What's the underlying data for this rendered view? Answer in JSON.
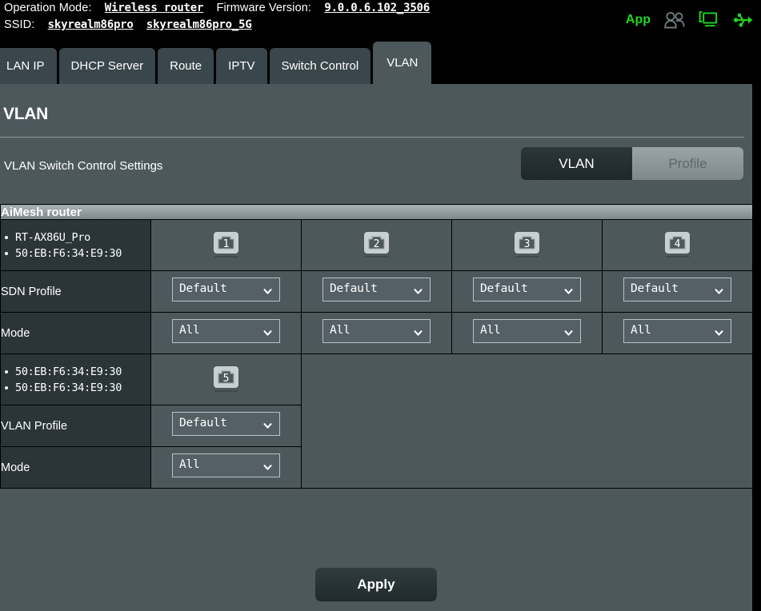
{
  "header": {
    "operation_mode_label": "Operation Mode:",
    "operation_mode_value": "Wireless router",
    "firmware_label": "Firmware Version:",
    "firmware_value": "9.0.0.6.102_3506",
    "ssid_label": "SSID:",
    "ssid_value_1": "skyrealm86pro",
    "ssid_value_2": "skyrealm86pro_5G",
    "app_label": "App",
    "icons": [
      "app-text",
      "users-icon",
      "monitor-icon",
      "usb-icon"
    ],
    "accent_green": "#1fd81f"
  },
  "tabs": [
    {
      "label": "LAN IP",
      "active": false
    },
    {
      "label": "DHCP Server",
      "active": false
    },
    {
      "label": "Route",
      "active": false
    },
    {
      "label": "IPTV",
      "active": false
    },
    {
      "label": "Switch Control",
      "active": false
    },
    {
      "label": "VLAN",
      "active": true
    }
  ],
  "page": {
    "title": "VLAN",
    "settings_label": "VLAN Switch Control Settings"
  },
  "view_toggle": {
    "vlan_label": "VLAN",
    "profile_label": "Profile",
    "selected": "VLAN"
  },
  "table": {
    "section_header": "AiMesh router",
    "blocks": [
      {
        "device": {
          "name": "RT-AX86U_Pro",
          "mac": "50:EB:F6:34:E9:30"
        },
        "ports": [
          "1",
          "2",
          "3",
          "4"
        ],
        "rows": [
          {
            "label": "SDN Profile",
            "values": [
              "Default",
              "Default",
              "Default",
              "Default"
            ]
          },
          {
            "label": "Mode",
            "values": [
              "All",
              "All",
              "All",
              "All"
            ]
          }
        ]
      },
      {
        "device": {
          "name": "50:EB:F6:34:E9:30",
          "mac": "50:EB:F6:34:E9:30"
        },
        "ports": [
          "5"
        ],
        "rows": [
          {
            "label": "VLAN Profile",
            "values": [
              "Default"
            ]
          },
          {
            "label": "Mode",
            "values": [
              "All"
            ]
          }
        ]
      }
    ]
  },
  "footer": {
    "apply_label": "Apply"
  },
  "colors": {
    "page_bg": "#4d585d",
    "dark_bg": "#000000",
    "label_col": "#2b3539",
    "tab_inactive": "#39464b",
    "accent_green": "#1fd81f",
    "header_row_top": "#a9b3b7",
    "header_row_bottom": "#7c878b"
  }
}
